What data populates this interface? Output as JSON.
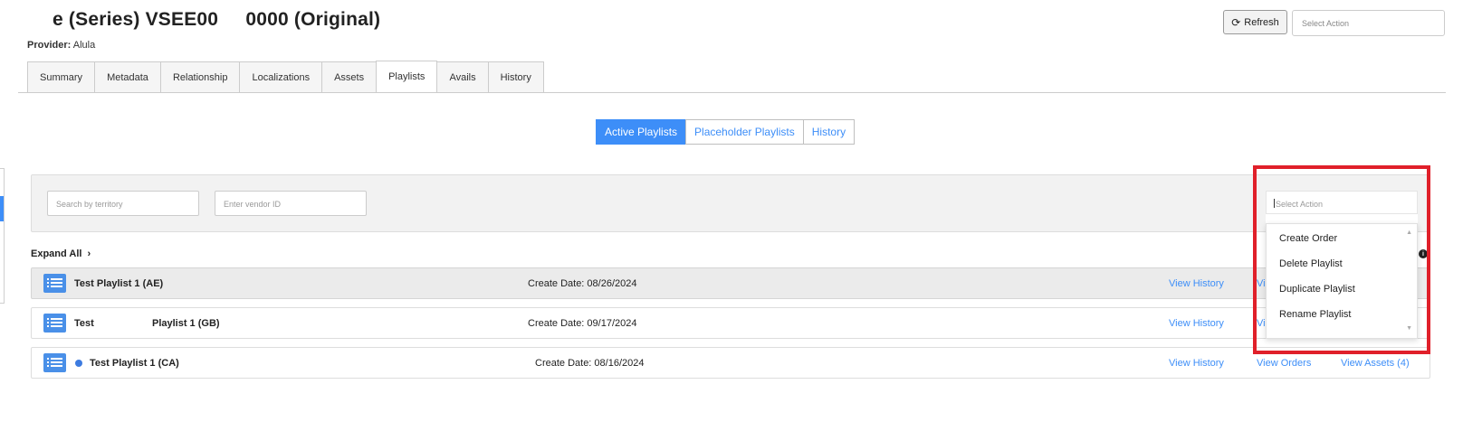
{
  "header": {
    "title": "e (Series) VSEE00     0000 (Original)",
    "provider_label": "Provider:",
    "provider_value": "Alula",
    "refresh_label": "Refresh",
    "action_placeholder": "Select Action"
  },
  "tabs": [
    {
      "label": "Summary"
    },
    {
      "label": "Metadata"
    },
    {
      "label": "Relationship"
    },
    {
      "label": "Localizations"
    },
    {
      "label": "Assets"
    },
    {
      "label": "Playlists"
    },
    {
      "label": "Avails"
    },
    {
      "label": "History"
    }
  ],
  "active_tab": "Playlists",
  "subtabs": [
    {
      "label": "Active Playlists"
    },
    {
      "label": "Placeholder Playlists"
    },
    {
      "label": "History"
    }
  ],
  "filters": {
    "territory_placeholder": "Search by territory",
    "vendor_placeholder": "Enter vendor ID"
  },
  "expand_all": "Expand All",
  "playlists": [
    {
      "name": "Test Playlist 1 (AE)",
      "create_date": "Create Date: 08/26/2024",
      "view_history": "View History",
      "view_orders": "Vi"
    },
    {
      "name": "Test                     Playlist 1 (GB)",
      "create_date": "Create Date: 09/17/2024",
      "view_history": "View History",
      "view_orders": "Vi"
    },
    {
      "name": "Test Playlist 1 (CA)",
      "create_date": "Create Date: 08/16/2024",
      "view_history": "View History",
      "view_orders": "View Orders",
      "view_assets": "View Assets (4)"
    }
  ],
  "dropdown": {
    "placeholder": "Select Action",
    "options": [
      "Create Order",
      "Delete Playlist",
      "Duplicate Playlist",
      "Rename Playlist"
    ]
  },
  "colors": {
    "accent": "#3d8ef8",
    "highlight": "#e0202a"
  }
}
